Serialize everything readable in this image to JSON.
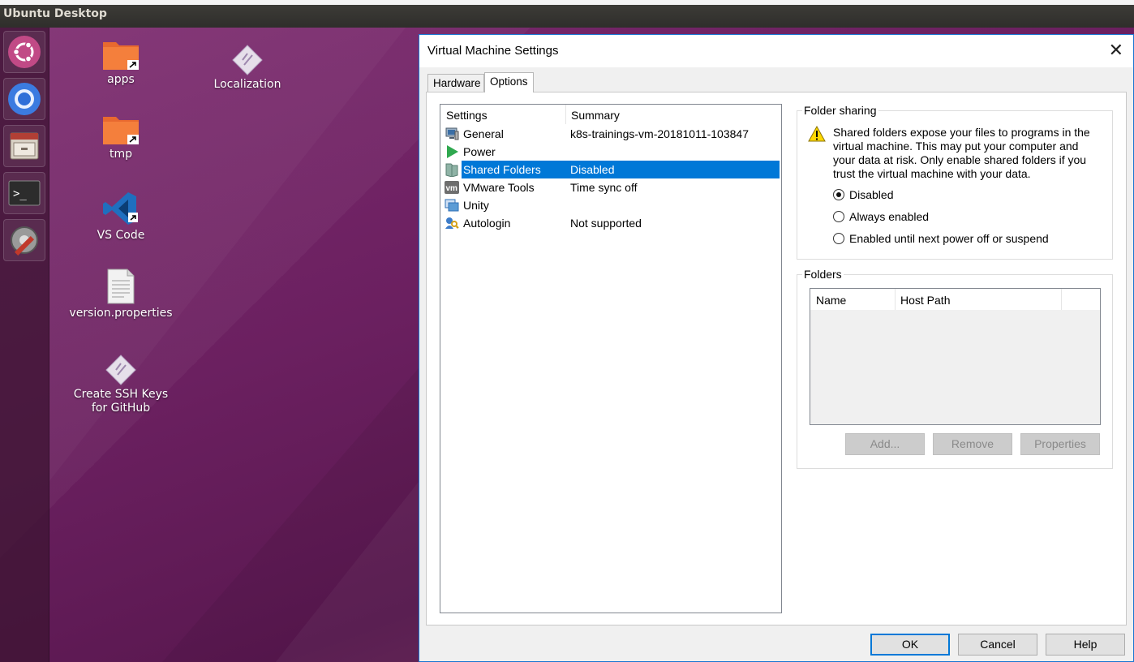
{
  "topbar": {
    "title": "Ubuntu Desktop"
  },
  "launcher": {
    "items": [
      {
        "icon": "ubuntu-logo-icon"
      },
      {
        "icon": "chromium-icon"
      },
      {
        "icon": "file-cabinet-icon"
      },
      {
        "icon": "terminal-icon"
      },
      {
        "icon": "system-settings-icon"
      }
    ]
  },
  "desktop": {
    "icons": [
      {
        "label": "apps",
        "icon": "folder-link-icon"
      },
      {
        "label": "tmp",
        "icon": "folder-link-icon"
      },
      {
        "label": "VS Code",
        "icon": "vscode-icon"
      },
      {
        "label": "version.properties",
        "icon": "text-file-icon"
      },
      {
        "label_line1": "Create SSH Keys",
        "label_line2": "for GitHub",
        "icon": "script-icon"
      },
      {
        "label": "Localization",
        "icon": "script-icon"
      }
    ]
  },
  "dialog": {
    "title": "Virtual Machine Settings",
    "close_glyph": "✕",
    "tabs": [
      {
        "label": "Hardware",
        "active": false
      },
      {
        "label": "Options",
        "active": true
      }
    ],
    "settings_list": {
      "columns": [
        "Settings",
        "Summary"
      ],
      "rows": [
        {
          "name": "General",
          "summary": "k8s-trainings-vm-20181011-103847",
          "icon": "monitor-icon"
        },
        {
          "name": "Power",
          "summary": "",
          "icon": "play-icon"
        },
        {
          "name": "Shared Folders",
          "summary": "Disabled",
          "icon": "shared-folder-icon",
          "selected": true
        },
        {
          "name": "VMware Tools",
          "summary": "Time sync off",
          "icon": "vmware-icon"
        },
        {
          "name": "Unity",
          "summary": "",
          "icon": "unity-window-icon"
        },
        {
          "name": "Autologin",
          "summary": "Not supported",
          "icon": "user-key-icon"
        }
      ]
    },
    "folder_sharing": {
      "label": "Folder sharing",
      "warning_icon": "warning-icon",
      "warning": "Shared folders expose your files to programs in the virtual machine. This may put your computer and your data at risk. Only enable shared folders if you trust the virtual machine with your data.",
      "options": [
        {
          "label": "Disabled",
          "checked": true
        },
        {
          "label": "Always enabled",
          "checked": false
        },
        {
          "label": "Enabled until next power off or suspend",
          "checked": false
        }
      ]
    },
    "folders": {
      "label": "Folders",
      "columns": [
        "Name",
        "Host Path"
      ],
      "buttons": {
        "add": "Add...",
        "remove": "Remove",
        "properties": "Properties"
      }
    },
    "footer": {
      "ok": "OK",
      "cancel": "Cancel",
      "help": "Help"
    },
    "accent_color": "#0078d7"
  }
}
